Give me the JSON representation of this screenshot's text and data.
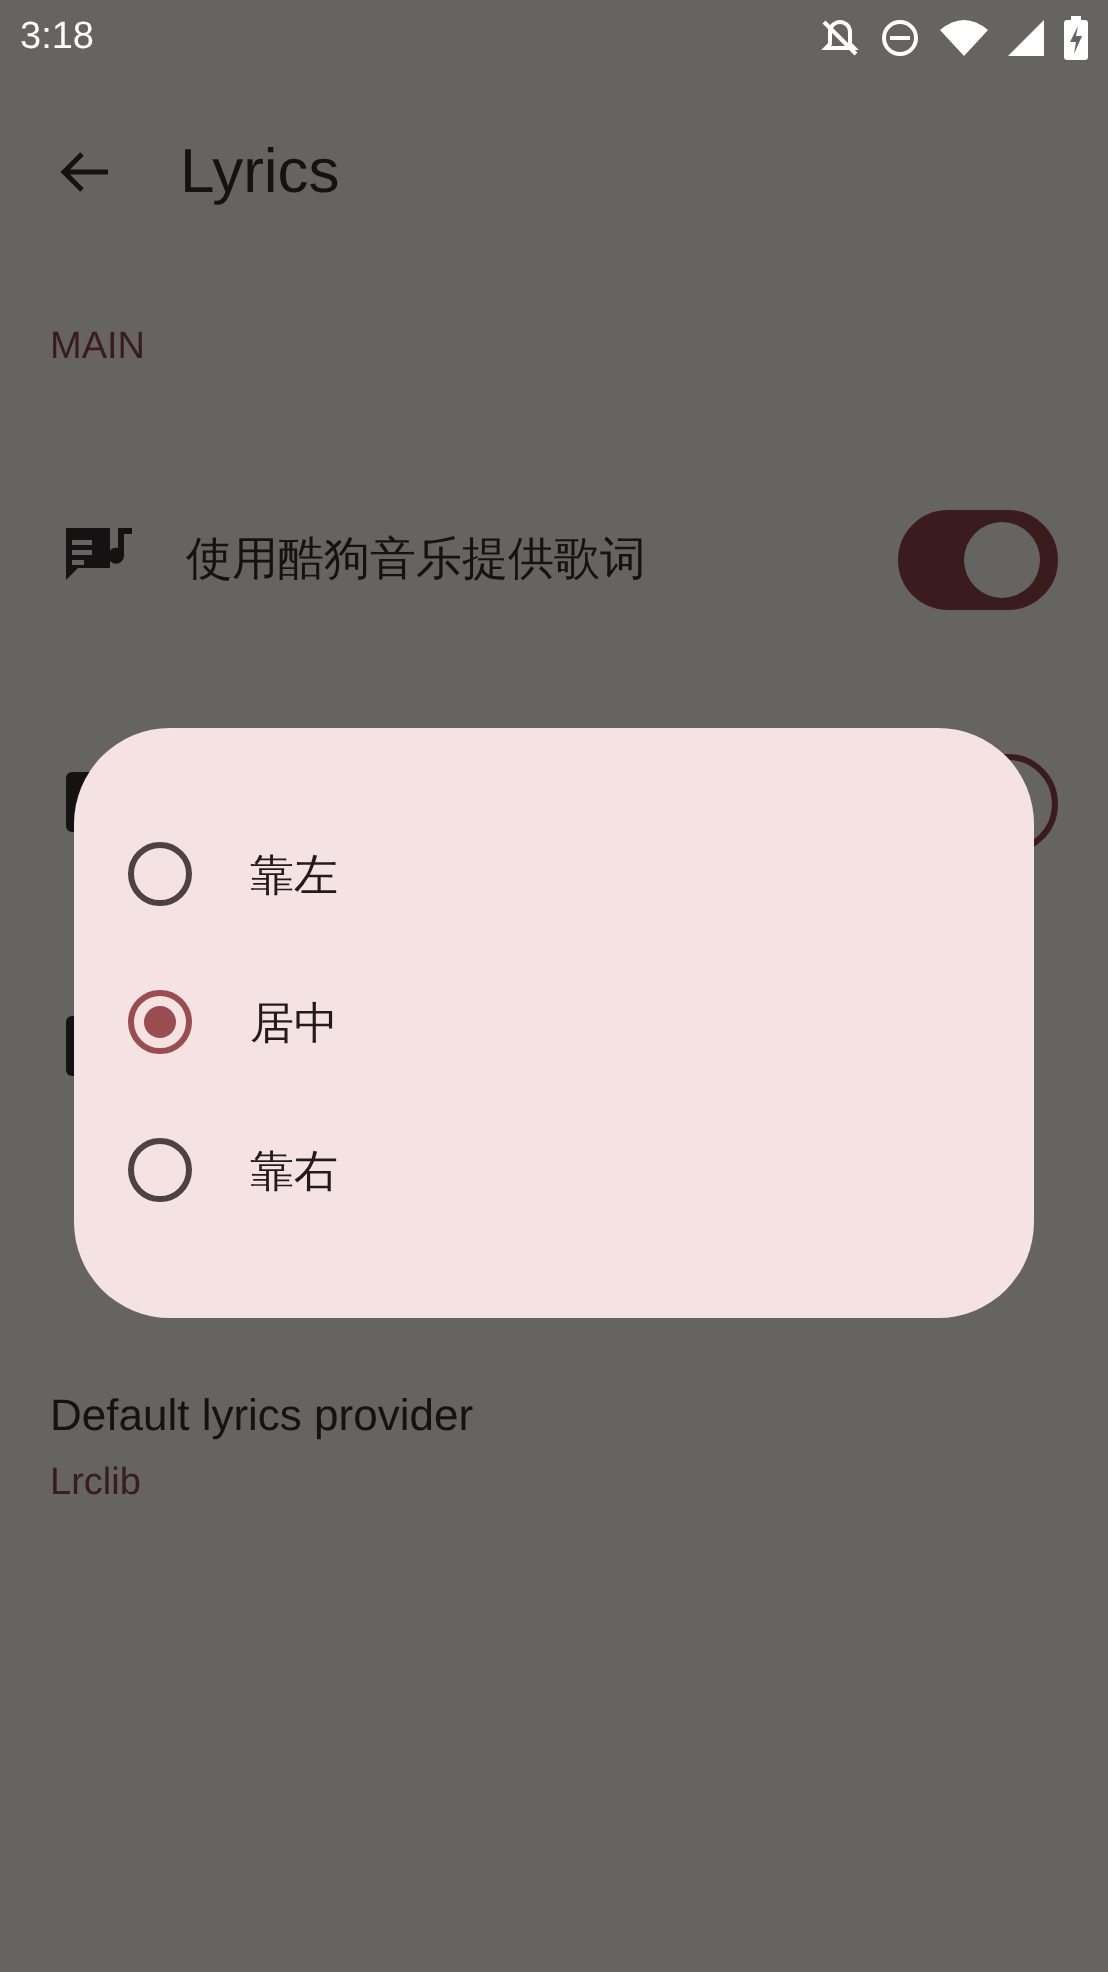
{
  "status_bar": {
    "time": "3:18"
  },
  "app_bar": {
    "title": "Lyrics"
  },
  "section": {
    "title": "MAIN"
  },
  "settings": [
    {
      "kind": "switch",
      "label": "使用酷狗音乐提供歌词",
      "on": true
    },
    {
      "kind": "switch",
      "on": false
    },
    {
      "kind": "plain"
    }
  ],
  "provider": {
    "title": "Default lyrics provider",
    "value": "Lrclib"
  },
  "dialog": {
    "options": [
      {
        "label": "靠左",
        "selected": false
      },
      {
        "label": "居中",
        "selected": true
      },
      {
        "label": "靠右",
        "selected": false
      }
    ]
  }
}
